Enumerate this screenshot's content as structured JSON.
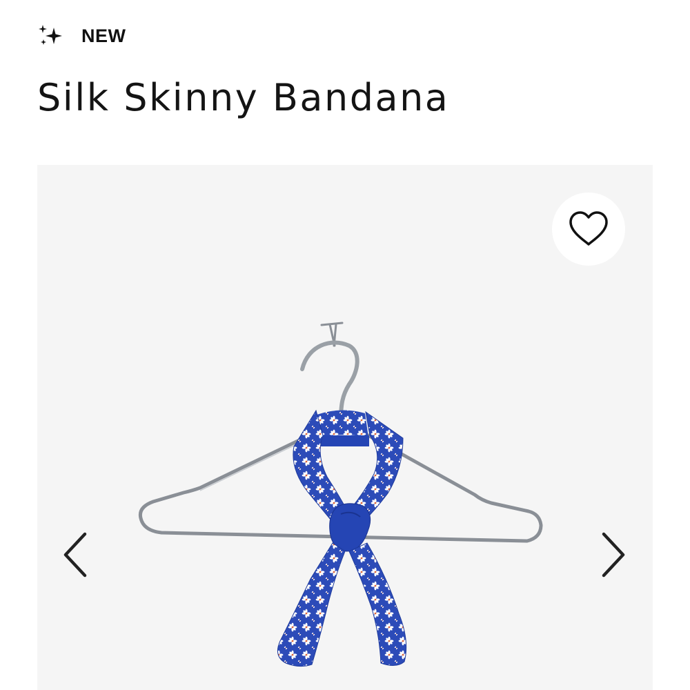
{
  "badge": {
    "icon": "sparkle-icon",
    "label": "NEW"
  },
  "product": {
    "title": "Silk Skinny Bandana"
  },
  "gallery": {
    "background_color": "#f5f5f5",
    "wishlist_icon": "heart-icon",
    "prev_icon": "chevron-left-icon",
    "next_icon": "chevron-right-icon",
    "scarf_color": "#2c4bb8",
    "flower_color": "#ffffff",
    "flower_center_color": "#d9643a",
    "hanger_color": "#8a8f96"
  }
}
